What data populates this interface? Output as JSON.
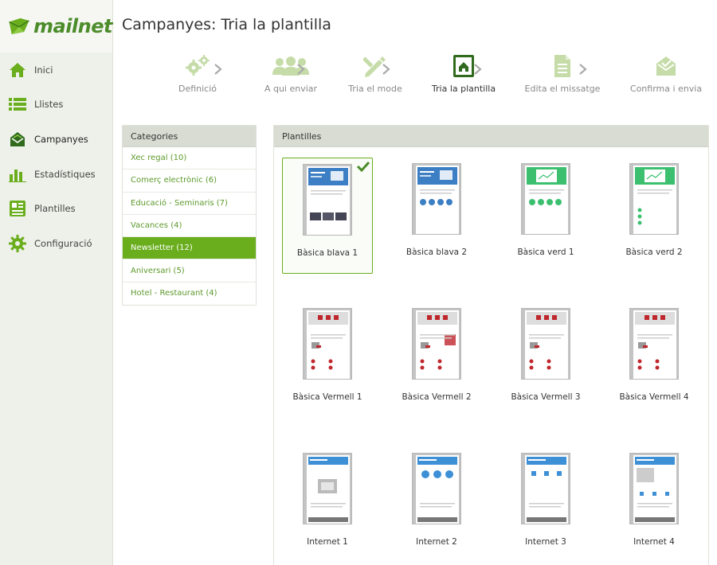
{
  "app": {
    "logo": "mailnet"
  },
  "colors": {
    "accent": "#6aae1e",
    "accent_dark": "#4c8c2b",
    "link": "#5d9a2c"
  },
  "sidebar": {
    "items": [
      {
        "label": "Inici",
        "icon": "home-icon"
      },
      {
        "label": "Llistes",
        "icon": "list-icon"
      },
      {
        "label": "Campanyes",
        "icon": "campaign-envelope-icon"
      },
      {
        "label": "Estadístiques",
        "icon": "bar-chart-icon"
      },
      {
        "label": "Plantilles",
        "icon": "template-icon"
      },
      {
        "label": "Configuració",
        "icon": "gear-icon"
      }
    ],
    "active": "Campanyes"
  },
  "page": {
    "title": "Campanyes: Tria la plantilla"
  },
  "steps": [
    {
      "label": "Definició",
      "icon": "gears-icon"
    },
    {
      "label": "A qui enviar",
      "icon": "users-icon"
    },
    {
      "label": "Tria el mode",
      "icon": "pencil-ruler-icon"
    },
    {
      "label": "Tria la plantilla",
      "icon": "template-house-icon"
    },
    {
      "label": "Edita el missatge",
      "icon": "document-icon"
    },
    {
      "label": "Confirma i envia",
      "icon": "envelope-check-icon"
    }
  ],
  "current_step": "Tria la plantilla",
  "categories": {
    "header": "Categories",
    "items": [
      "Xec regal (10)",
      "Comerç electrònic (6)",
      "Educació - Seminaris (7)",
      "Vacances (4)",
      "Newsletter (12)",
      "Aniversari (5)",
      "Hotel - Restaurant (4)"
    ],
    "selected": "Newsletter (12)"
  },
  "templates": {
    "header": "Plantilles",
    "items": [
      {
        "label": "Bàsica blava 1",
        "style": "blue"
      },
      {
        "label": "Bàsica blava 2",
        "style": "blue2"
      },
      {
        "label": "Bàsica verd 1",
        "style": "green"
      },
      {
        "label": "Bàsica verd 2",
        "style": "green2"
      },
      {
        "label": "Bàsica Vermell 1",
        "style": "red"
      },
      {
        "label": "Bàsica Vermell 2",
        "style": "red2"
      },
      {
        "label": "Bàsica Vermell 3",
        "style": "red"
      },
      {
        "label": "Bàsica Vermell 4",
        "style": "red"
      },
      {
        "label": "Internet 1",
        "style": "net1"
      },
      {
        "label": "Internet 2",
        "style": "net2"
      },
      {
        "label": "Internet 3",
        "style": "net3"
      },
      {
        "label": "Internet 4",
        "style": "net4"
      }
    ],
    "selected": "Bàsica blava 1"
  }
}
